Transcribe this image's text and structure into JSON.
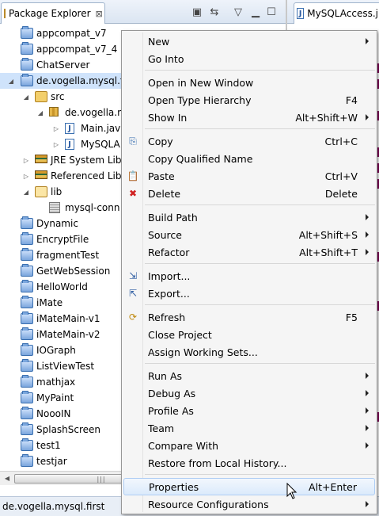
{
  "explorer": {
    "tab_label": "Package Explorer",
    "tab_close": "⊠",
    "editor_tab_label": "MySQLAccess.j"
  },
  "tree": {
    "items": [
      {
        "label": "appcompat_v7",
        "icon": "project-folder-icon",
        "depth": 0,
        "arrow": ""
      },
      {
        "label": "appcompat_v7_4",
        "icon": "project-folder-icon",
        "depth": 0,
        "arrow": ""
      },
      {
        "label": "ChatServer",
        "icon": "project-folder-icon",
        "depth": 0,
        "arrow": ""
      },
      {
        "label": "de.vogella.mysql.fi",
        "icon": "project-folder-icon",
        "depth": 0,
        "arrow": "◢"
      },
      {
        "label": "src",
        "icon": "source-folder-icon",
        "depth": 1,
        "arrow": "◢"
      },
      {
        "label": "de.vogella.n",
        "icon": "package-icon",
        "depth": 2,
        "arrow": "◢"
      },
      {
        "label": "Main.jav",
        "icon": "java-file-icon",
        "depth": 3,
        "arrow": "▷"
      },
      {
        "label": "MySQLA",
        "icon": "java-file-icon",
        "depth": 3,
        "arrow": "▷"
      },
      {
        "label": "JRE System Lib",
        "icon": "library-icon",
        "depth": 1,
        "arrow": "▷"
      },
      {
        "label": "Referenced Lib",
        "icon": "library-icon",
        "depth": 1,
        "arrow": "▷"
      },
      {
        "label": "lib",
        "icon": "open-folder-icon",
        "depth": 1,
        "arrow": "◢"
      },
      {
        "label": "mysql-conn",
        "icon": "jar-file-icon",
        "depth": 2,
        "arrow": ""
      },
      {
        "label": "Dynamic",
        "icon": "project-folder-icon",
        "depth": 0,
        "arrow": ""
      },
      {
        "label": "EncryptFile",
        "icon": "project-folder-icon",
        "depth": 0,
        "arrow": ""
      },
      {
        "label": "fragmentTest",
        "icon": "project-folder-icon",
        "depth": 0,
        "arrow": ""
      },
      {
        "label": "GetWebSession",
        "icon": "project-folder-icon",
        "depth": 0,
        "arrow": ""
      },
      {
        "label": "HelloWorld",
        "icon": "project-folder-icon",
        "depth": 0,
        "arrow": ""
      },
      {
        "label": "iMate",
        "icon": "project-folder-icon",
        "depth": 0,
        "arrow": ""
      },
      {
        "label": "iMateMain-v1",
        "icon": "project-folder-icon",
        "depth": 0,
        "arrow": ""
      },
      {
        "label": "iMateMain-v2",
        "icon": "project-folder-icon",
        "depth": 0,
        "arrow": ""
      },
      {
        "label": "IOGraph",
        "icon": "project-folder-icon",
        "depth": 0,
        "arrow": ""
      },
      {
        "label": "ListViewTest",
        "icon": "project-folder-icon",
        "depth": 0,
        "arrow": ""
      },
      {
        "label": "mathjax",
        "icon": "project-folder-icon",
        "depth": 0,
        "arrow": ""
      },
      {
        "label": "MyPaint",
        "icon": "project-folder-icon",
        "depth": 0,
        "arrow": ""
      },
      {
        "label": "NoooIN",
        "icon": "project-folder-icon",
        "depth": 0,
        "arrow": ""
      },
      {
        "label": "SplashScreen",
        "icon": "project-folder-icon",
        "depth": 0,
        "arrow": ""
      },
      {
        "label": "test1",
        "icon": "project-folder-icon",
        "depth": 0,
        "arrow": ""
      },
      {
        "label": "testjar",
        "icon": "project-folder-icon",
        "depth": 0,
        "arrow": ""
      }
    ],
    "selected_index": 3
  },
  "status": {
    "text": "de.vogella.mysql.first"
  },
  "menu": {
    "groups": [
      [
        {
          "label": "New",
          "shortcut": "",
          "submenu": true,
          "icon": ""
        },
        {
          "label": "Go Into",
          "shortcut": "",
          "submenu": false,
          "icon": ""
        }
      ],
      [
        {
          "label": "Open in New Window",
          "shortcut": "",
          "submenu": false,
          "icon": ""
        },
        {
          "label": "Open Type Hierarchy",
          "shortcut": "F4",
          "submenu": false,
          "icon": ""
        },
        {
          "label": "Show In",
          "shortcut": "Alt+Shift+W",
          "submenu": true,
          "icon": ""
        }
      ],
      [
        {
          "label": "Copy",
          "shortcut": "Ctrl+C",
          "submenu": false,
          "icon": "copy-icon"
        },
        {
          "label": "Copy Qualified Name",
          "shortcut": "",
          "submenu": false,
          "icon": ""
        },
        {
          "label": "Paste",
          "shortcut": "Ctrl+V",
          "submenu": false,
          "icon": "paste-icon"
        },
        {
          "label": "Delete",
          "shortcut": "Delete",
          "submenu": false,
          "icon": "delete-icon"
        }
      ],
      [
        {
          "label": "Build Path",
          "shortcut": "",
          "submenu": true,
          "icon": ""
        },
        {
          "label": "Source",
          "shortcut": "Alt+Shift+S",
          "submenu": true,
          "icon": ""
        },
        {
          "label": "Refactor",
          "shortcut": "Alt+Shift+T",
          "submenu": true,
          "icon": ""
        }
      ],
      [
        {
          "label": "Import...",
          "shortcut": "",
          "submenu": false,
          "icon": "import-icon"
        },
        {
          "label": "Export...",
          "shortcut": "",
          "submenu": false,
          "icon": "export-icon"
        }
      ],
      [
        {
          "label": "Refresh",
          "shortcut": "F5",
          "submenu": false,
          "icon": "refresh-icon"
        },
        {
          "label": "Close Project",
          "shortcut": "",
          "submenu": false,
          "icon": ""
        },
        {
          "label": "Assign Working Sets...",
          "shortcut": "",
          "submenu": false,
          "icon": ""
        }
      ],
      [
        {
          "label": "Run As",
          "shortcut": "",
          "submenu": true,
          "icon": ""
        },
        {
          "label": "Debug As",
          "shortcut": "",
          "submenu": true,
          "icon": ""
        },
        {
          "label": "Profile As",
          "shortcut": "",
          "submenu": true,
          "icon": ""
        },
        {
          "label": "Team",
          "shortcut": "",
          "submenu": true,
          "icon": ""
        },
        {
          "label": "Compare With",
          "shortcut": "",
          "submenu": true,
          "icon": ""
        },
        {
          "label": "Restore from Local History...",
          "shortcut": "",
          "submenu": false,
          "icon": ""
        }
      ],
      [
        {
          "label": "Properties",
          "shortcut": "Alt+Enter",
          "submenu": false,
          "icon": "",
          "hover": true
        },
        {
          "label": "Resource Configurations",
          "shortcut": "",
          "submenu": true,
          "icon": ""
        }
      ]
    ]
  },
  "colors": {
    "selection": "#cfe3fb",
    "menu_hover": "#dbeafb",
    "keyword": "#7f0055"
  }
}
